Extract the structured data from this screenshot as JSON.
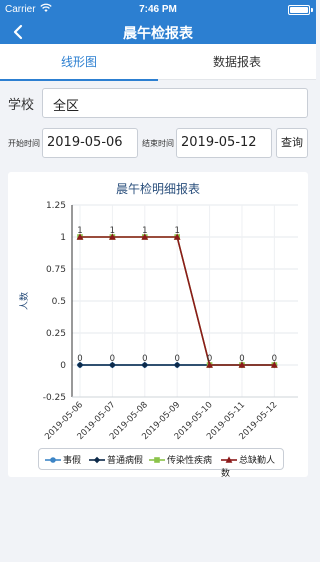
{
  "status_bar": {
    "carrier": "Carrier",
    "time": "7:46 PM"
  },
  "nav": {
    "title": "晨午检报表"
  },
  "tabs": [
    {
      "label": "线形图",
      "active": true
    },
    {
      "label": "数据报表",
      "active": false
    }
  ],
  "filters": {
    "school_label": "学校",
    "school_value": "全区",
    "start_label": "开始时间",
    "start_value": "2019-05-06",
    "end_label": "结束时间",
    "end_value": "2019-05-12",
    "query_label": "查询"
  },
  "chart_data": {
    "type": "line",
    "title": "晨午检明细报表",
    "ylabel": "人数",
    "xlabel": "",
    "categories": [
      "2019-05-06",
      "2019-05-07",
      "2019-05-08",
      "2019-05-09",
      "2019-05-10",
      "2019-05-11",
      "2019-05-12"
    ],
    "ylim": [
      -0.25,
      1.25
    ],
    "yticks": [
      1.25,
      1,
      0.75,
      0.5,
      0.25,
      0,
      -0.25
    ],
    "grid": true,
    "legend_position": "bottom",
    "series": [
      {
        "name": "事假",
        "color": "#3d85c6",
        "marker": "circle",
        "values": [
          0,
          0,
          0,
          0,
          0,
          0,
          0
        ]
      },
      {
        "name": "普通病假",
        "color": "#0d2a4a",
        "marker": "diamond",
        "values": [
          0,
          0,
          0,
          0,
          0,
          0,
          0
        ]
      },
      {
        "name": "传染性疾病",
        "color": "#8bc34a",
        "marker": "square",
        "values": [
          1,
          1,
          1,
          1,
          0,
          0,
          0
        ]
      },
      {
        "name": "总缺勤人数",
        "color": "#8b1a1a",
        "marker": "triangle",
        "values": [
          1,
          1,
          1,
          1,
          0,
          0,
          0
        ]
      }
    ],
    "data_labels": [
      1,
      1,
      1,
      1,
      0,
      0,
      0
    ],
    "data_labels_lower": [
      0,
      0,
      0,
      0
    ]
  }
}
